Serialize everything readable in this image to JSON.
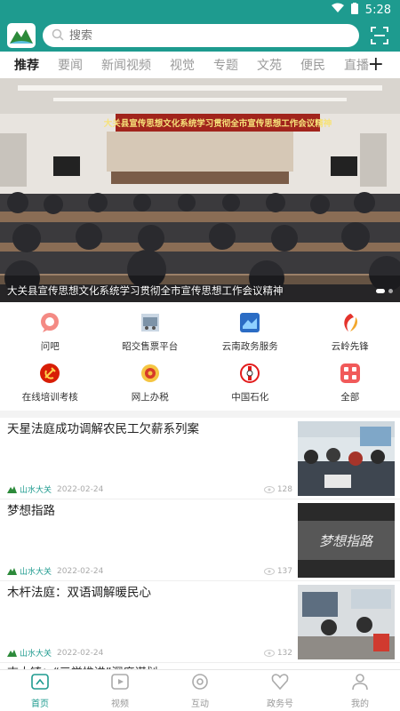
{
  "status": {
    "time": "5:28"
  },
  "search": {
    "placeholder": "搜索"
  },
  "tabs": [
    "推荐",
    "要闻",
    "新闻视频",
    "视觉",
    "专题",
    "文苑",
    "便民",
    "直播"
  ],
  "hero": {
    "caption": "大关县宣传思想文化系统学习贯彻全市宣传思想工作会议精神",
    "banner": "大关县宣传思想文化系统学习贯彻全市宣传思想工作会议精神"
  },
  "services": [
    {
      "label": "问吧",
      "icon": "chat-bubble-icon"
    },
    {
      "label": "昭交售票平台",
      "icon": "bus-ticket-icon"
    },
    {
      "label": "云南政务服务",
      "icon": "government-service-icon"
    },
    {
      "label": "云岭先锋",
      "icon": "pioneer-icon"
    },
    {
      "label": "在线培训考核",
      "icon": "party-emblem-icon"
    },
    {
      "label": "网上办税",
      "icon": "tax-emblem-icon"
    },
    {
      "label": "中国石化",
      "icon": "sinopec-icon"
    },
    {
      "label": "全部",
      "icon": "all-apps-icon"
    }
  ],
  "news": [
    {
      "title": "天星法庭成功调解农民工欠薪系列案",
      "source": "山水大关",
      "date": "2022-02-24",
      "views": "128"
    },
    {
      "title": "梦想指路",
      "source": "山水大关",
      "date": "2022-02-24",
      "views": "137",
      "thumb_text": "梦想指路"
    },
    {
      "title": "木杆法庭：双语调解暖民心",
      "source": "山水大关",
      "date": "2022-02-24",
      "views": "132"
    }
  ],
  "partial_title": "吉大镇：“三学推进”深度谋划…",
  "bottom_nav": [
    {
      "label": "首页",
      "icon": "home-icon"
    },
    {
      "label": "视频",
      "icon": "video-icon"
    },
    {
      "label": "互动",
      "icon": "interaction-icon"
    },
    {
      "label": "政务号",
      "icon": "gov-account-icon"
    },
    {
      "label": "我的",
      "icon": "profile-icon"
    }
  ],
  "colors": {
    "accent": "#1e9b8f",
    "inactive": "#999999"
  }
}
